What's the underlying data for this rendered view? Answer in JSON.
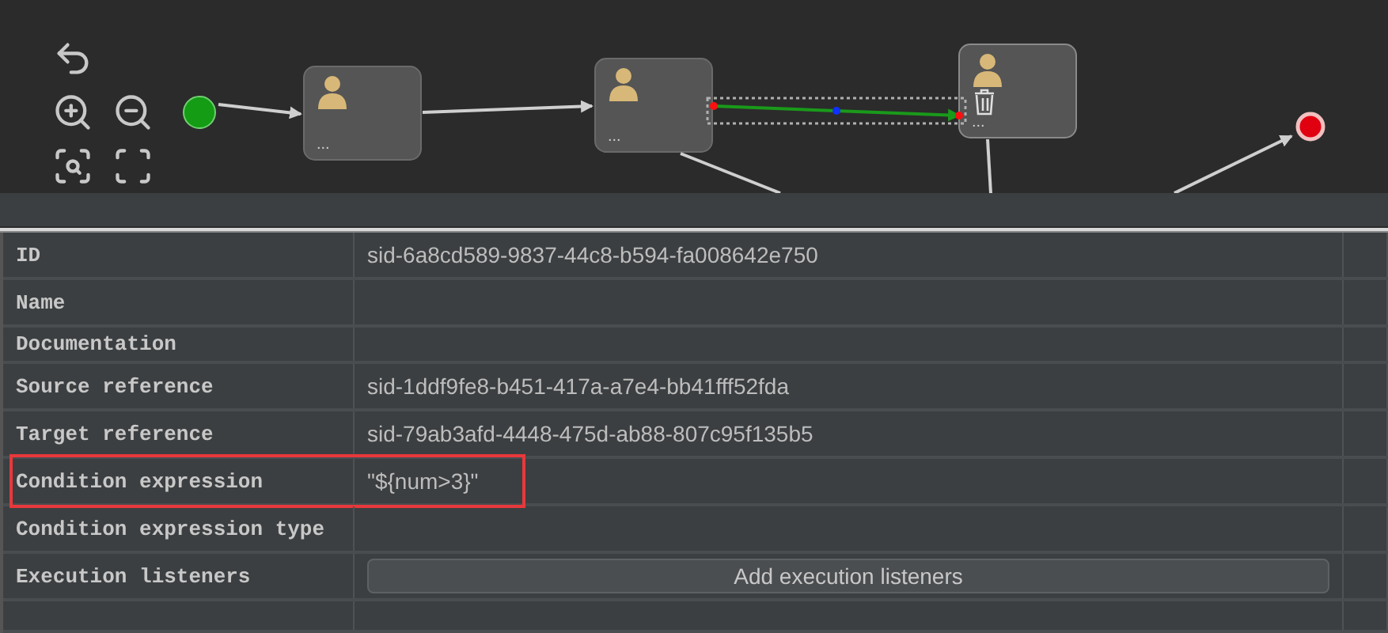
{
  "diagram": {
    "tasks": [
      {
        "label": "...",
        "selected": false
      },
      {
        "label": "...",
        "selected": false
      },
      {
        "label": "...",
        "selected": true
      }
    ],
    "flows": [
      {
        "selected": false
      },
      {
        "selected": false
      },
      {
        "selected": true
      },
      {
        "selected": false
      },
      {
        "selected": false
      },
      {
        "selected": false
      }
    ]
  },
  "properties": [
    {
      "kind": "text",
      "label": "ID",
      "value": "sid-6a8cd589-9837-44c8-b594-fa008642e750",
      "highlighted": false
    },
    {
      "kind": "text",
      "label": "Name",
      "highlighted": false
    },
    {
      "kind": "text",
      "label": "Documentation",
      "highlighted": false
    },
    {
      "kind": "text",
      "label": "Source reference",
      "value": "sid-1ddf9fe8-b451-417a-a7e4-bb41fff52fda",
      "highlighted": false
    },
    {
      "kind": "text",
      "label": "Target reference",
      "value": "sid-79ab3afd-4448-475d-ab88-807c95f135b5",
      "highlighted": false
    },
    {
      "kind": "text",
      "label": "Condition expression",
      "value": "\"${num>3}\"",
      "highlighted": true
    },
    {
      "kind": "text",
      "label": "Condition expression type",
      "highlighted": false
    },
    {
      "kind": "button",
      "label": "Execution listeners",
      "button": "Add execution listeners",
      "highlighted": false
    }
  ]
}
